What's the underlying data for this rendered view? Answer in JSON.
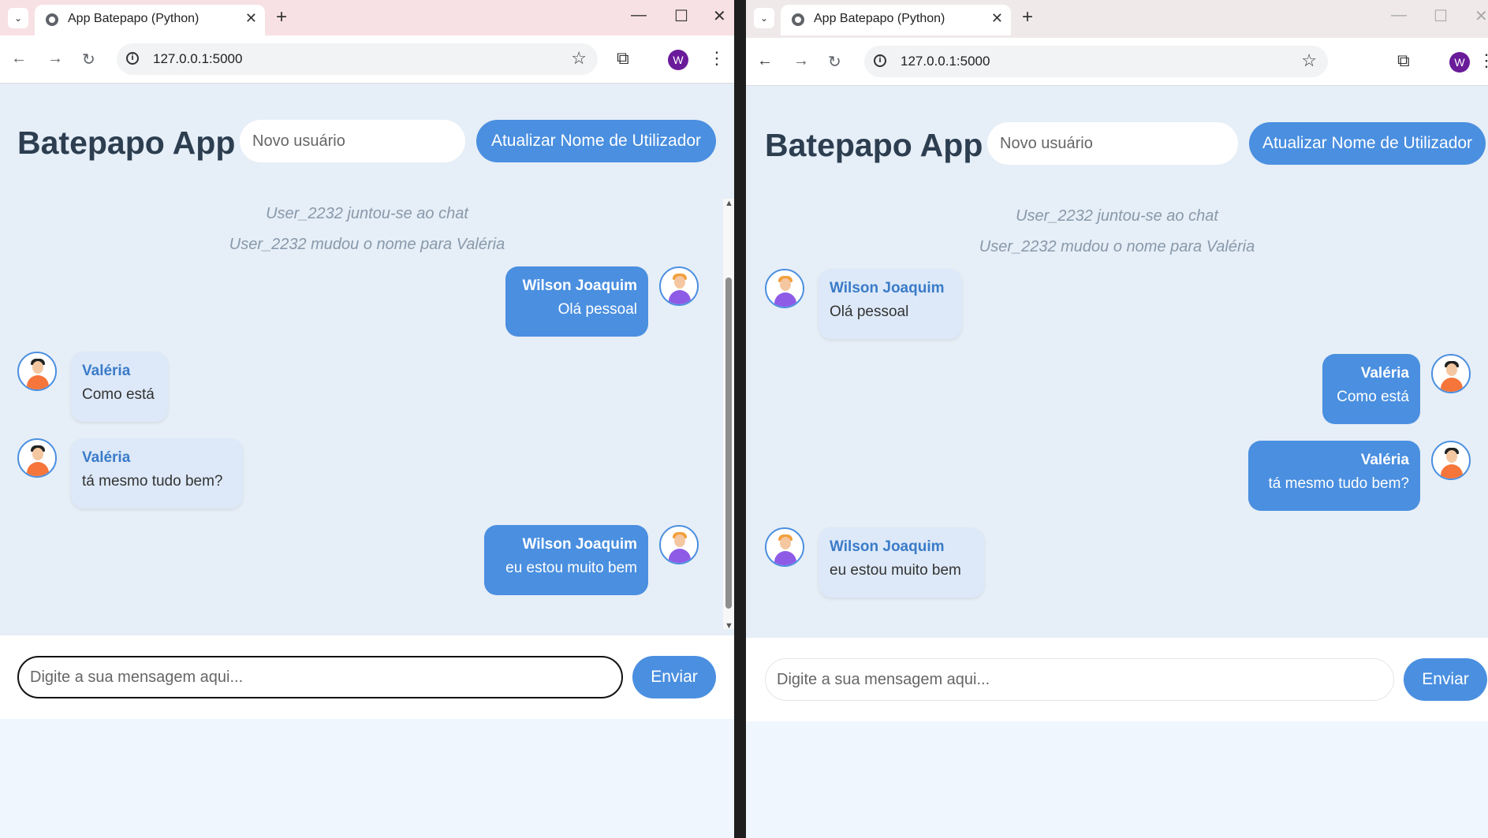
{
  "browser": {
    "tab_title": "App Batepapo (Python)",
    "url": "127.0.0.1:5000",
    "profile_initial": "W"
  },
  "app": {
    "title": "Batepapo App",
    "name_placeholder": "Novo usuário",
    "update_button": "Atualizar Nome de Utilizador",
    "message_placeholder": "Digite a sua mensagem aqui...",
    "send_button": "Enviar"
  },
  "system_messages": [
    "User_2232 juntou-se ao chat",
    "User_2232 mudou o nome para Valéria"
  ],
  "messages": [
    {
      "author": "Wilson Joaquim",
      "text": "Olá pessoal"
    },
    {
      "author": "Valéria",
      "text": "Como está"
    },
    {
      "author": "Valéria",
      "text": "tá mesmo tudo bem?"
    },
    {
      "author": "Wilson Joaquim",
      "text": "eu estou muito bem"
    }
  ],
  "colors": {
    "accent": "#4a8fe0",
    "title": "#2c3e50",
    "background": "#e6eef7"
  }
}
